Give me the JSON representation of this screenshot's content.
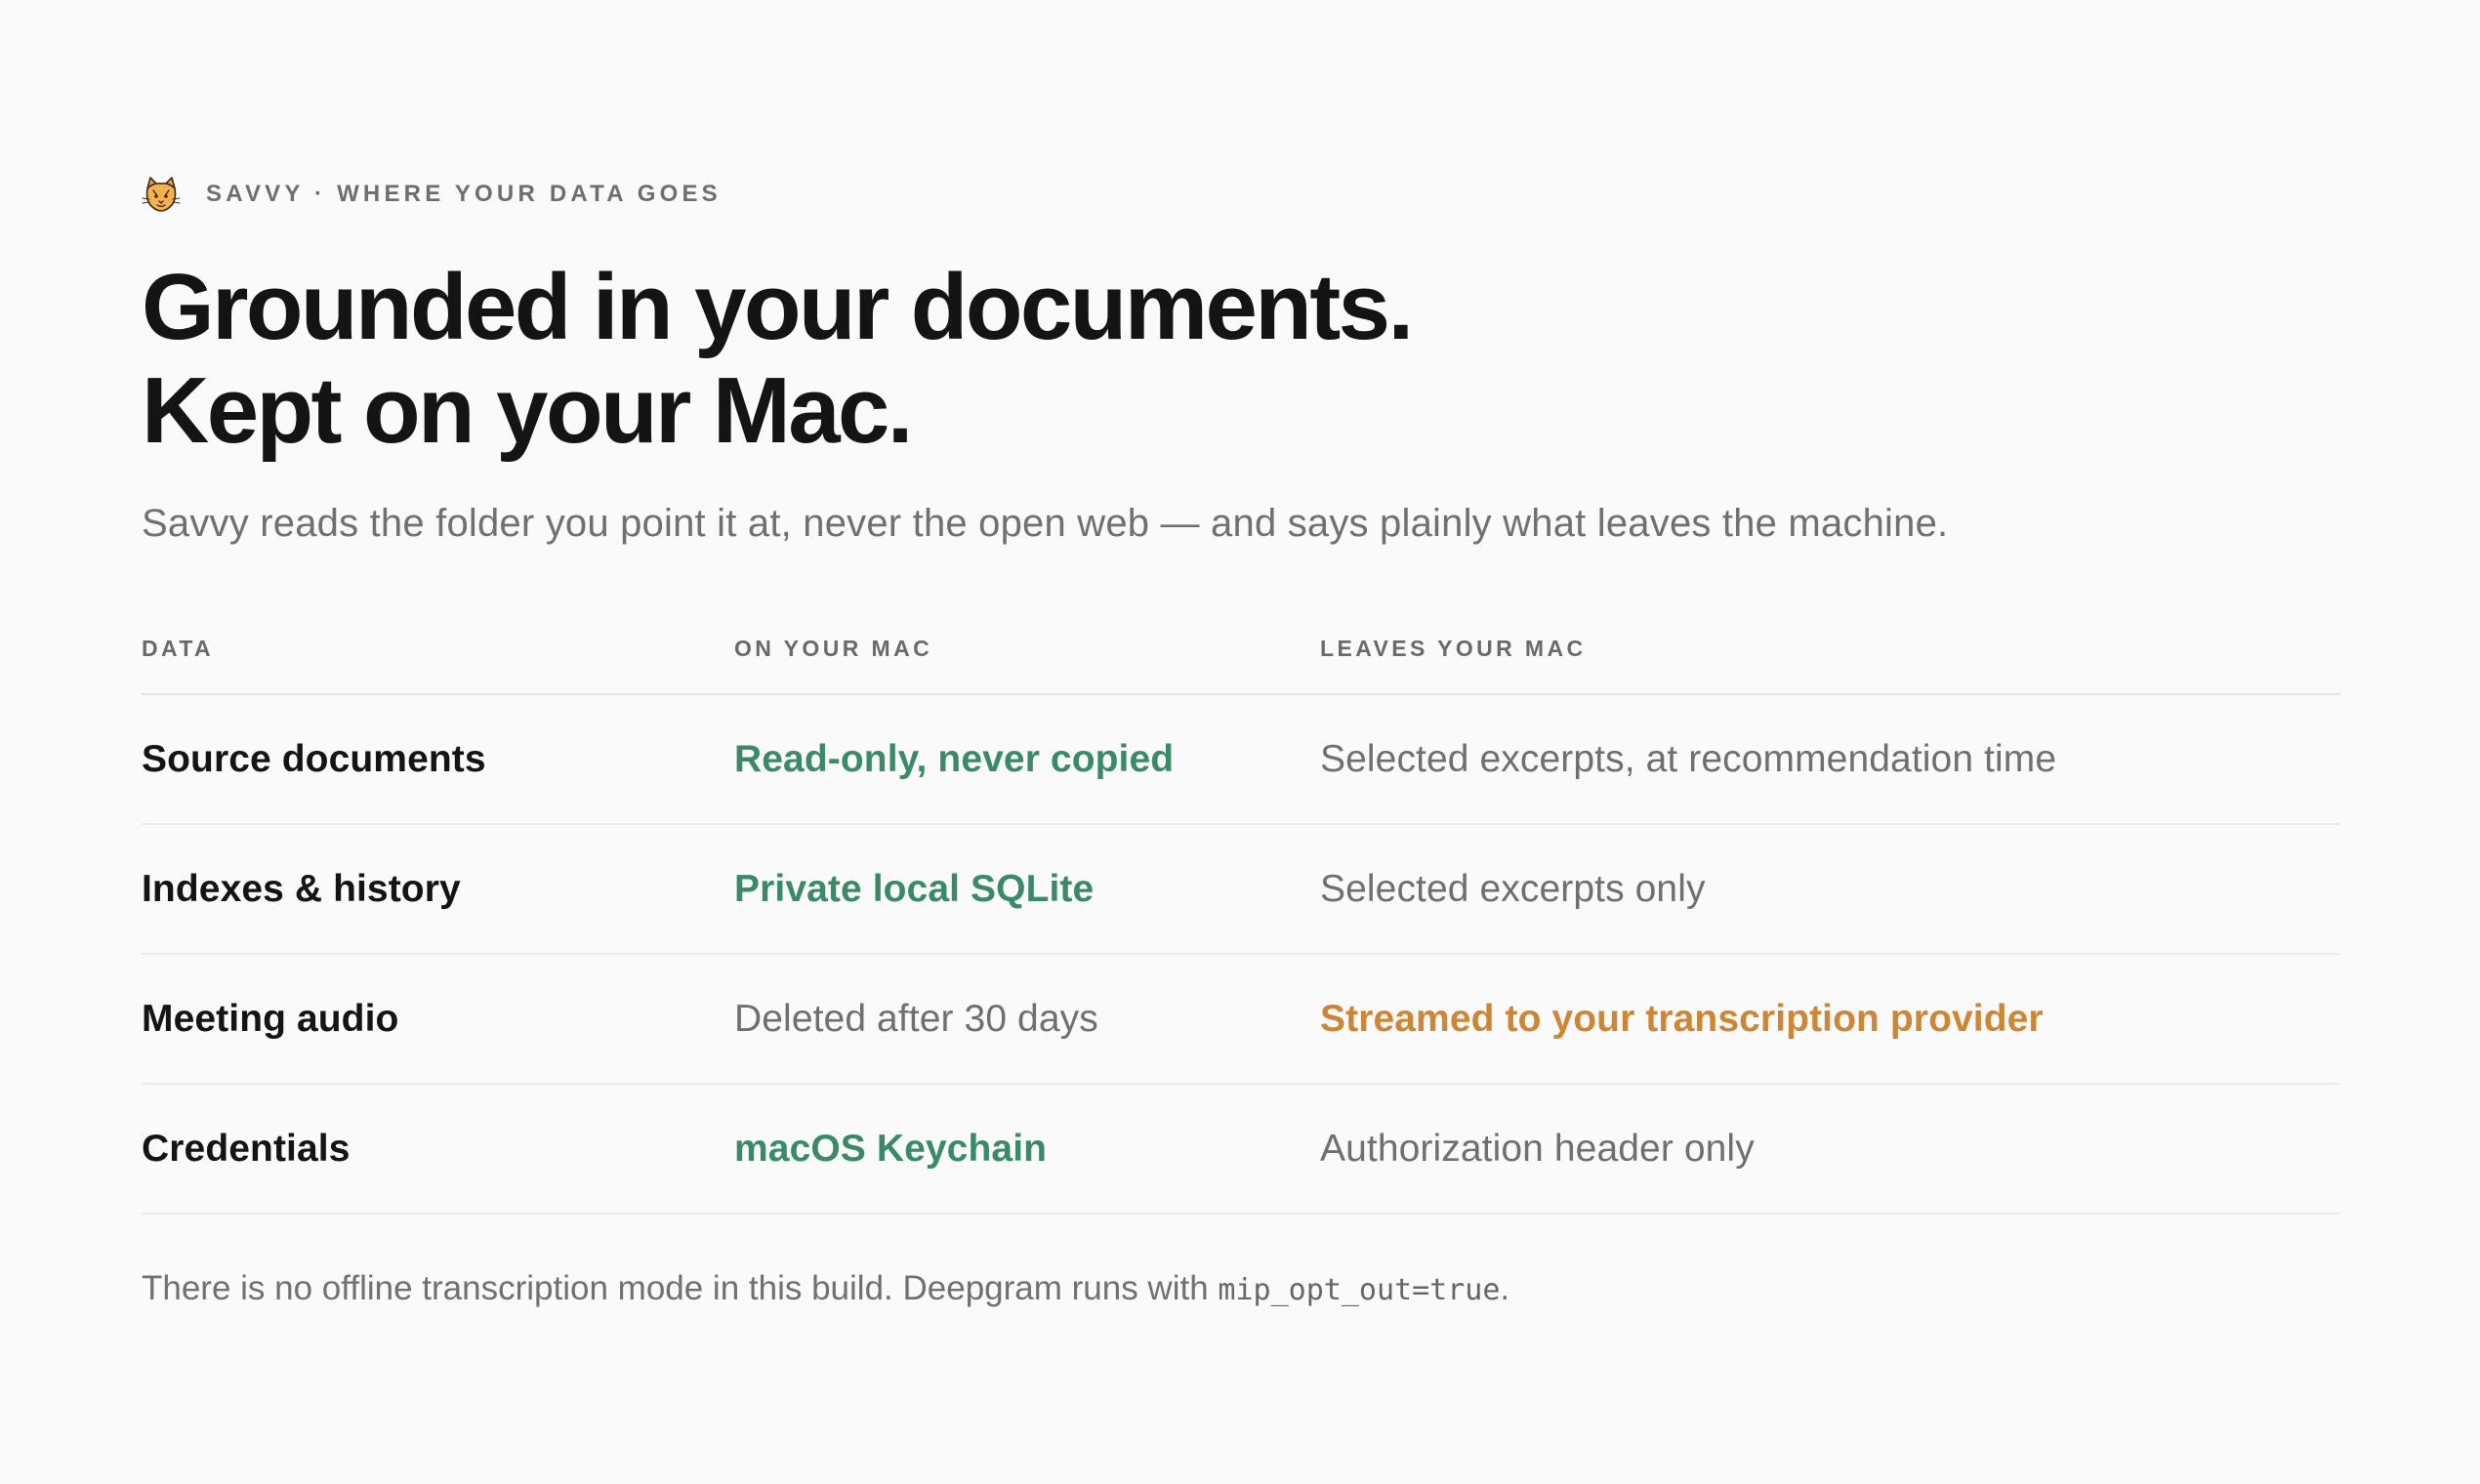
{
  "eyebrow": {
    "logo_icon": "cat-logo-icon",
    "text": "SAVVY · WHERE YOUR DATA GOES"
  },
  "headline": {
    "line1": "Grounded in your documents.",
    "line2": "Kept on your Mac."
  },
  "subtitle": "Savvy reads the folder you point it at, never the open web — and says plainly what leaves the machine.",
  "table": {
    "headers": [
      "DATA",
      "ON YOUR MAC",
      "LEAVES YOUR MAC"
    ],
    "rows": [
      {
        "data": "Source documents",
        "on_mac": "Read-only, never copied",
        "leaves": "Selected excerpts, at recommendation time"
      },
      {
        "data": "Indexes & history",
        "on_mac": "Private local SQLite",
        "leaves": "Selected excerpts only"
      },
      {
        "data": "Meeting audio",
        "on_mac": "Deleted after 30 days",
        "leaves": "Streamed to your transcription provider"
      },
      {
        "data": "Credentials",
        "on_mac": "macOS Keychain",
        "leaves": "Authorization header only"
      }
    ]
  },
  "footnote": {
    "text": "There is no offline transcription mode in this build. Deepgram runs with ",
    "code": "mip_opt_out=true",
    "end": "."
  },
  "colors": {
    "accent_green": "#3a8a68",
    "accent_orange": "#cd8636",
    "muted": "#6f6f6f",
    "background": "#fafafa"
  }
}
